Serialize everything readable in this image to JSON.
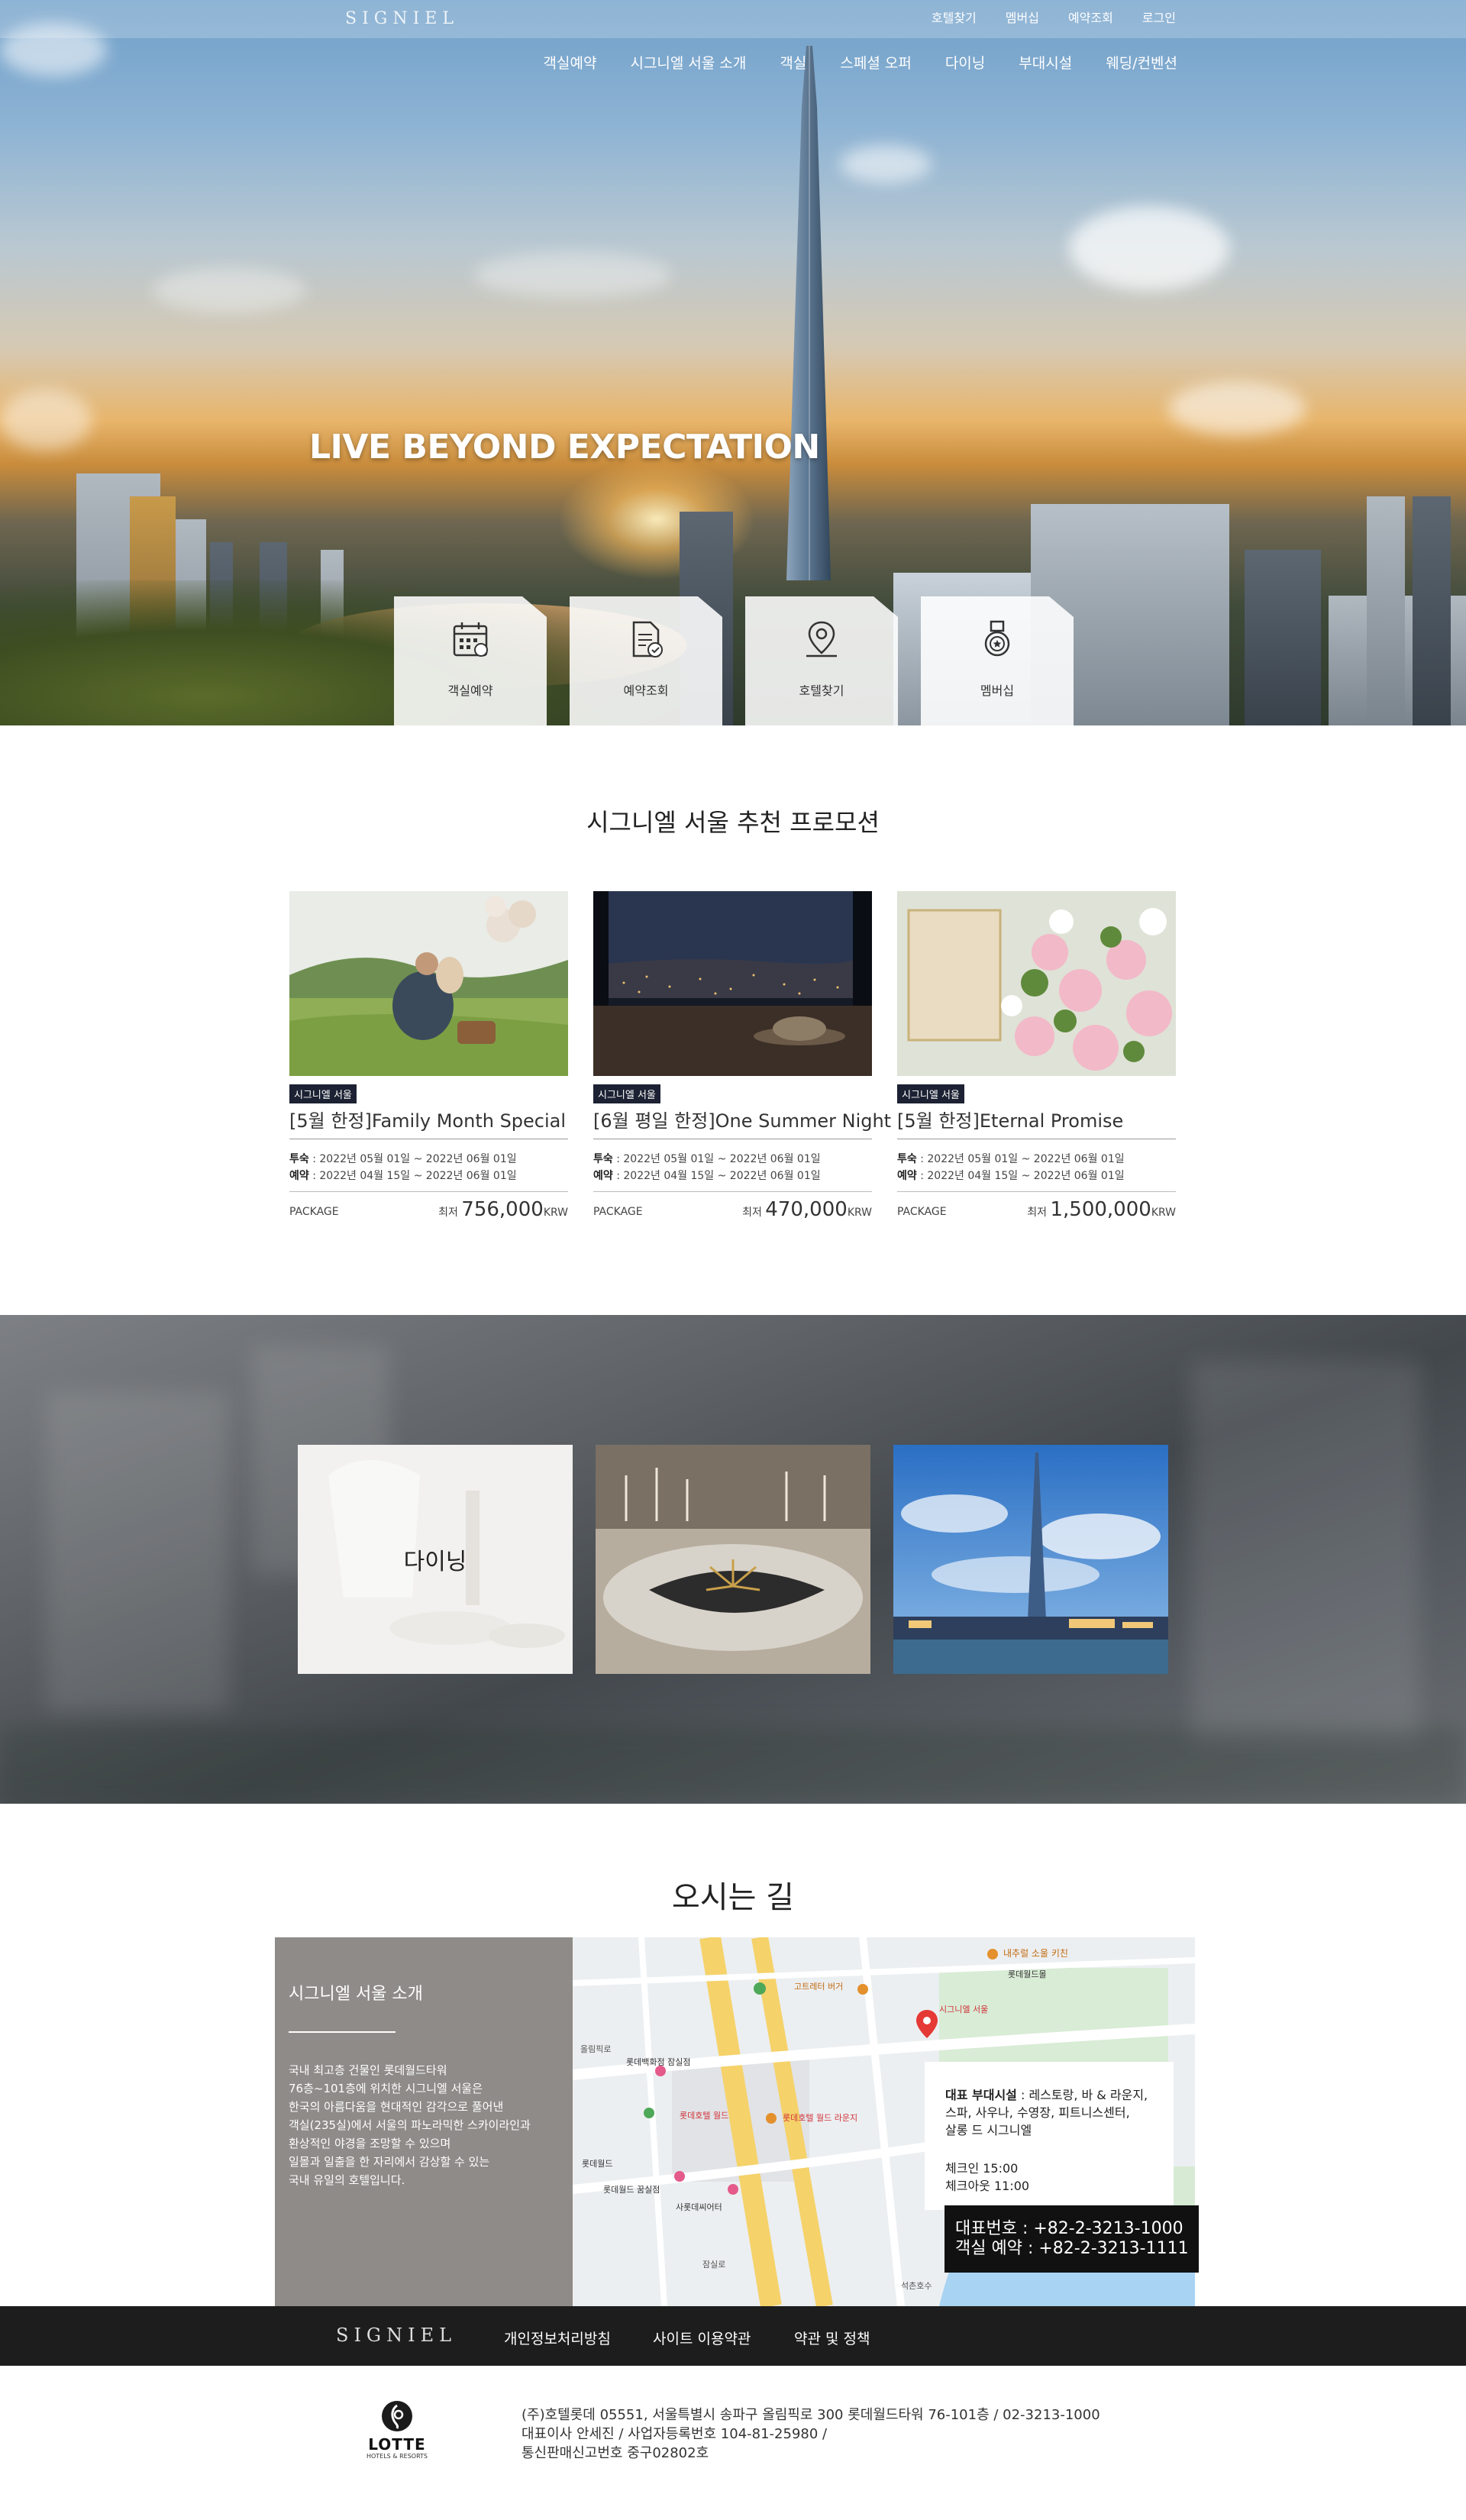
{
  "brand": {
    "logo": "SIGNIEL"
  },
  "util_nav": [
    "호텔찾기",
    "멤버십",
    "예약조회",
    "로그인"
  ],
  "gnb": [
    "객실예약",
    "시그니엘 서울 소개",
    "객실",
    "스페셜 오퍼",
    "다이닝",
    "부대시설",
    "웨딩/컨벤션"
  ],
  "hero": {
    "slogan": "LIVE BEYOND EXPECTATION"
  },
  "quick_menu": [
    {
      "label": "객실예약",
      "icon": "calendar-icon"
    },
    {
      "label": "예약조회",
      "icon": "document-check-icon"
    },
    {
      "label": "호텔찾기",
      "icon": "map-pin-icon"
    },
    {
      "label": "멤버십",
      "icon": "medal-icon"
    }
  ],
  "promotions": {
    "title": "시그니엘 서울 추천 프로모션",
    "cards": [
      {
        "badge": "시그니엘 서울",
        "title": "[5월 한정]Family Month Special",
        "stay_label": "투숙",
        "stay": " : 2022년 05월 01일 ~ 2022년 06월 01일",
        "book_label": "예약",
        "book": " : 2022년 04월 15일 ~ 2022년 06월 01일",
        "package": "PACKAGE",
        "price_prefix": "최저 ",
        "price": "756,000",
        "currency": "KRW"
      },
      {
        "badge": "시그니엘 서울",
        "title": "[6월 평일 한정]One Summer Night",
        "stay_label": "투숙",
        "stay": " : 2022년 05월 01일 ~ 2022년 06월 01일",
        "book_label": "예약",
        "book": " : 2022년 04월 15일 ~ 2022년 06월 01일",
        "package": "PACKAGE",
        "price_prefix": "최저 ",
        "price": "470,000",
        "currency": "KRW"
      },
      {
        "badge": "시그니엘 서울",
        "title": "[5월 한정]Eternal Promise",
        "stay_label": "투숙",
        "stay": " : 2022년 05월 01일 ~ 2022년 06월 01일",
        "book_label": "예약",
        "book": " : 2022년 04월 15일 ~ 2022년 06월 01일",
        "package": "PACKAGE",
        "price_prefix": "최저 ",
        "price": "1,500,000",
        "currency": "KRW"
      }
    ]
  },
  "features": {
    "dining_label": "다이닝"
  },
  "location": {
    "title": "오시는 길",
    "intro_title": "시그니엘 서울 소개",
    "intro_lines": [
      "국내 최고층 건물인 롯데월드타워",
      "76층~101층에 위치한 시그니엘 서울은",
      "한국의 아름다움을 현대적인 감각으로 풀어낸",
      "객실(235실)에서 서울의 파노라믹한 스카이라인과",
      "환상적인 야경을 조망할 수 있으며",
      "일몰과 일출을 한 자리에서 감상할 수 있는",
      "국내 유일의 호텔입니다."
    ],
    "facilities_label": "대표 부대시설",
    "facilities_lines": [
      " : 레스토랑,  바 & 라운지,",
      "스파, 사우나,  수영장,  피트니스센터,",
      "살롱 드 시그니엘"
    ],
    "checkin": "체크인 15:00",
    "checkout": "체크아웃 11:00",
    "phone_main": "대표번호 : +82-2-3213-1000",
    "phone_rooms": "객실 예약 : +82-2-3213-1111",
    "map_labels": {
      "l1": "내추럴 소울 키친",
      "l2": "롯데월드몰",
      "l3": "고트레터 버거",
      "l4": "롯데백화점 잠실점",
      "l5": "롯데호텔 월드",
      "l6": "롯데호텔 월드 라운지",
      "l7": "롯데월드",
      "l8": "롯데월드 꿈실점",
      "l9": "사롯데씨어터",
      "l10": "시그니엘 서울",
      "l11": "잠실로",
      "l12": "올림픽로",
      "l13": "석촌호수"
    }
  },
  "footer": {
    "logo": "SIGNIEL",
    "links": [
      "개인정보처리방침",
      "사이트 이용약관",
      "약관 및 정책"
    ],
    "company_logo": "LOTTE",
    "company_sub": "HOTELS & RESORTS",
    "address_lines": [
      "(주)호텔롯데 05551, 서울특별시 송파구 올림픽로 300 롯데월드타워 76-101층 / 02-3213-1000",
      "대표이사 안세진 / 사업자등록번호 104-81-25980 /",
      "통신판매신고번호 중구02802호"
    ]
  },
  "colors": {
    "badge": "#1c2233",
    "info_panel": "#8e8b88",
    "footer_bar": "#1d1d1d"
  }
}
